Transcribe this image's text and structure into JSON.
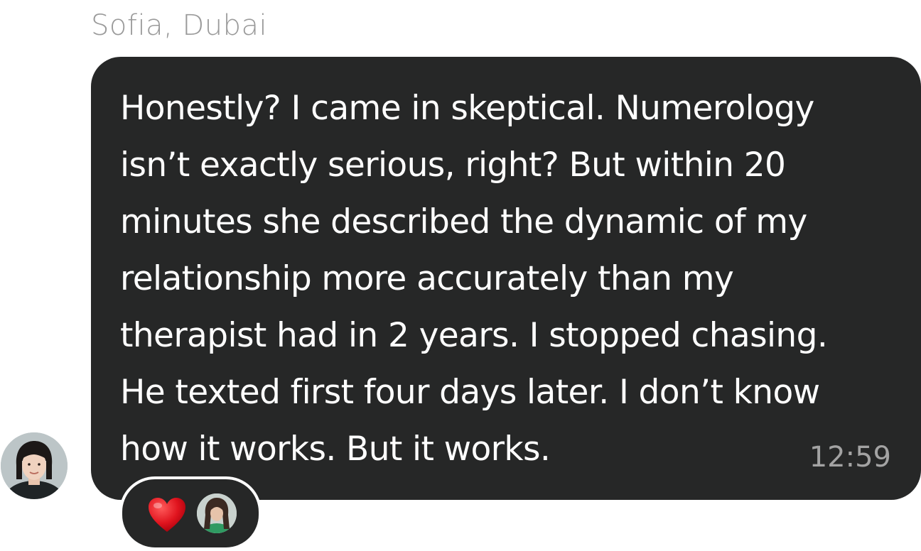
{
  "message": {
    "sender": "Sofia, Dubai",
    "text": "Honestly? I came in skeptical. Numerology\nisn’t exactly serious, right? But within 20\nminutes she described the dynamic of my\nrelationship more accurately than my\ntherapist had in 2 years. I stopped chasing.\nHe texted first four days later. I don’t know\nhow it works. But it works.",
    "time": "12:59",
    "bubble_color": "#262727",
    "text_color": "#ffffff"
  },
  "avatar": {
    "icon": "sender-avatar-photo"
  },
  "reaction": {
    "emoji_icon": "red-heart-icon",
    "emoji_color": "#e0141e",
    "reactor_icon": "reactor-avatar-photo"
  }
}
